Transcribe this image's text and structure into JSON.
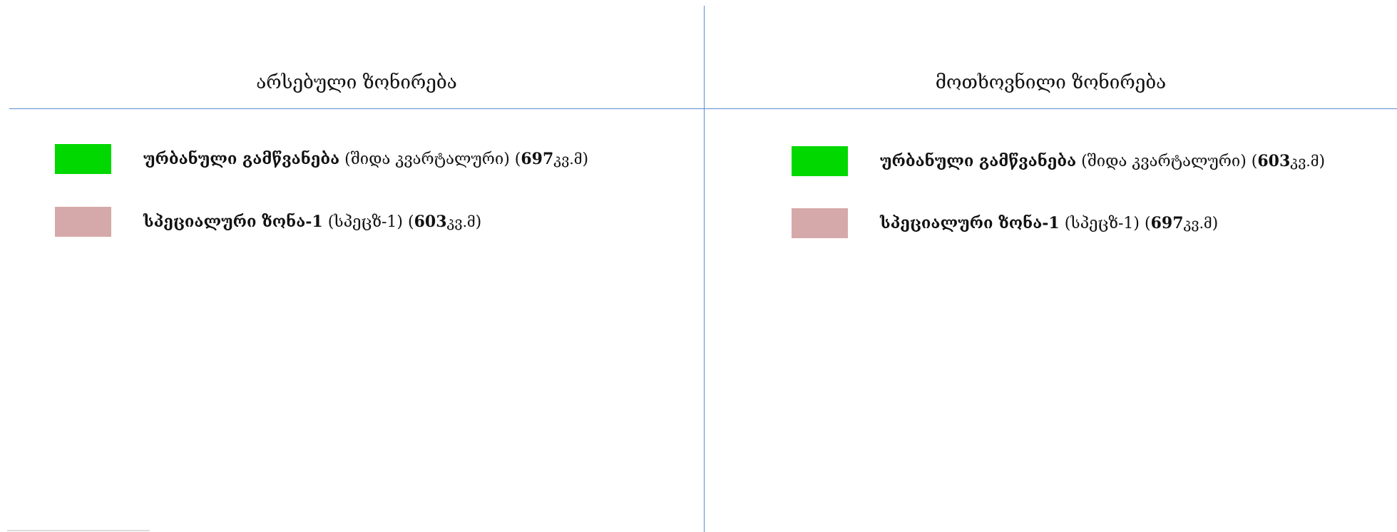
{
  "left_panel": {
    "title": "არსებული ზონირება",
    "items": [
      {
        "name": "ურბანული გამწვანება",
        "detail": " (შიდა კვარტალური) (",
        "area": "697",
        "unit": "კვ.მ",
        "close": ")",
        "color": "#00d800"
      },
      {
        "name": "სპეციალური ზონა-1",
        "detail": " (სპეცზ-1) (",
        "area": "603",
        "unit": "კვ.მ",
        "close": ")",
        "color": "#d5a9a9"
      }
    ]
  },
  "right_panel": {
    "title": "მოთხოვნილი ზონირება",
    "items": [
      {
        "name": "ურბანული გამწვანება",
        "detail": " (შიდა კვარტალური) (",
        "area": "603",
        "unit": "კვ.მ",
        "close": ")",
        "color": "#00d800"
      },
      {
        "name": "სპეციალური ზონა-1",
        "detail": " (სპეცზ-1) (",
        "area": "697",
        "unit": "კვ.მ",
        "close": ")",
        "color": "#d5a9a9"
      }
    ]
  },
  "colors": {
    "divider": "#5b8fcf",
    "urban_green": "#00d800",
    "special_zone": "#d5a9a9"
  }
}
